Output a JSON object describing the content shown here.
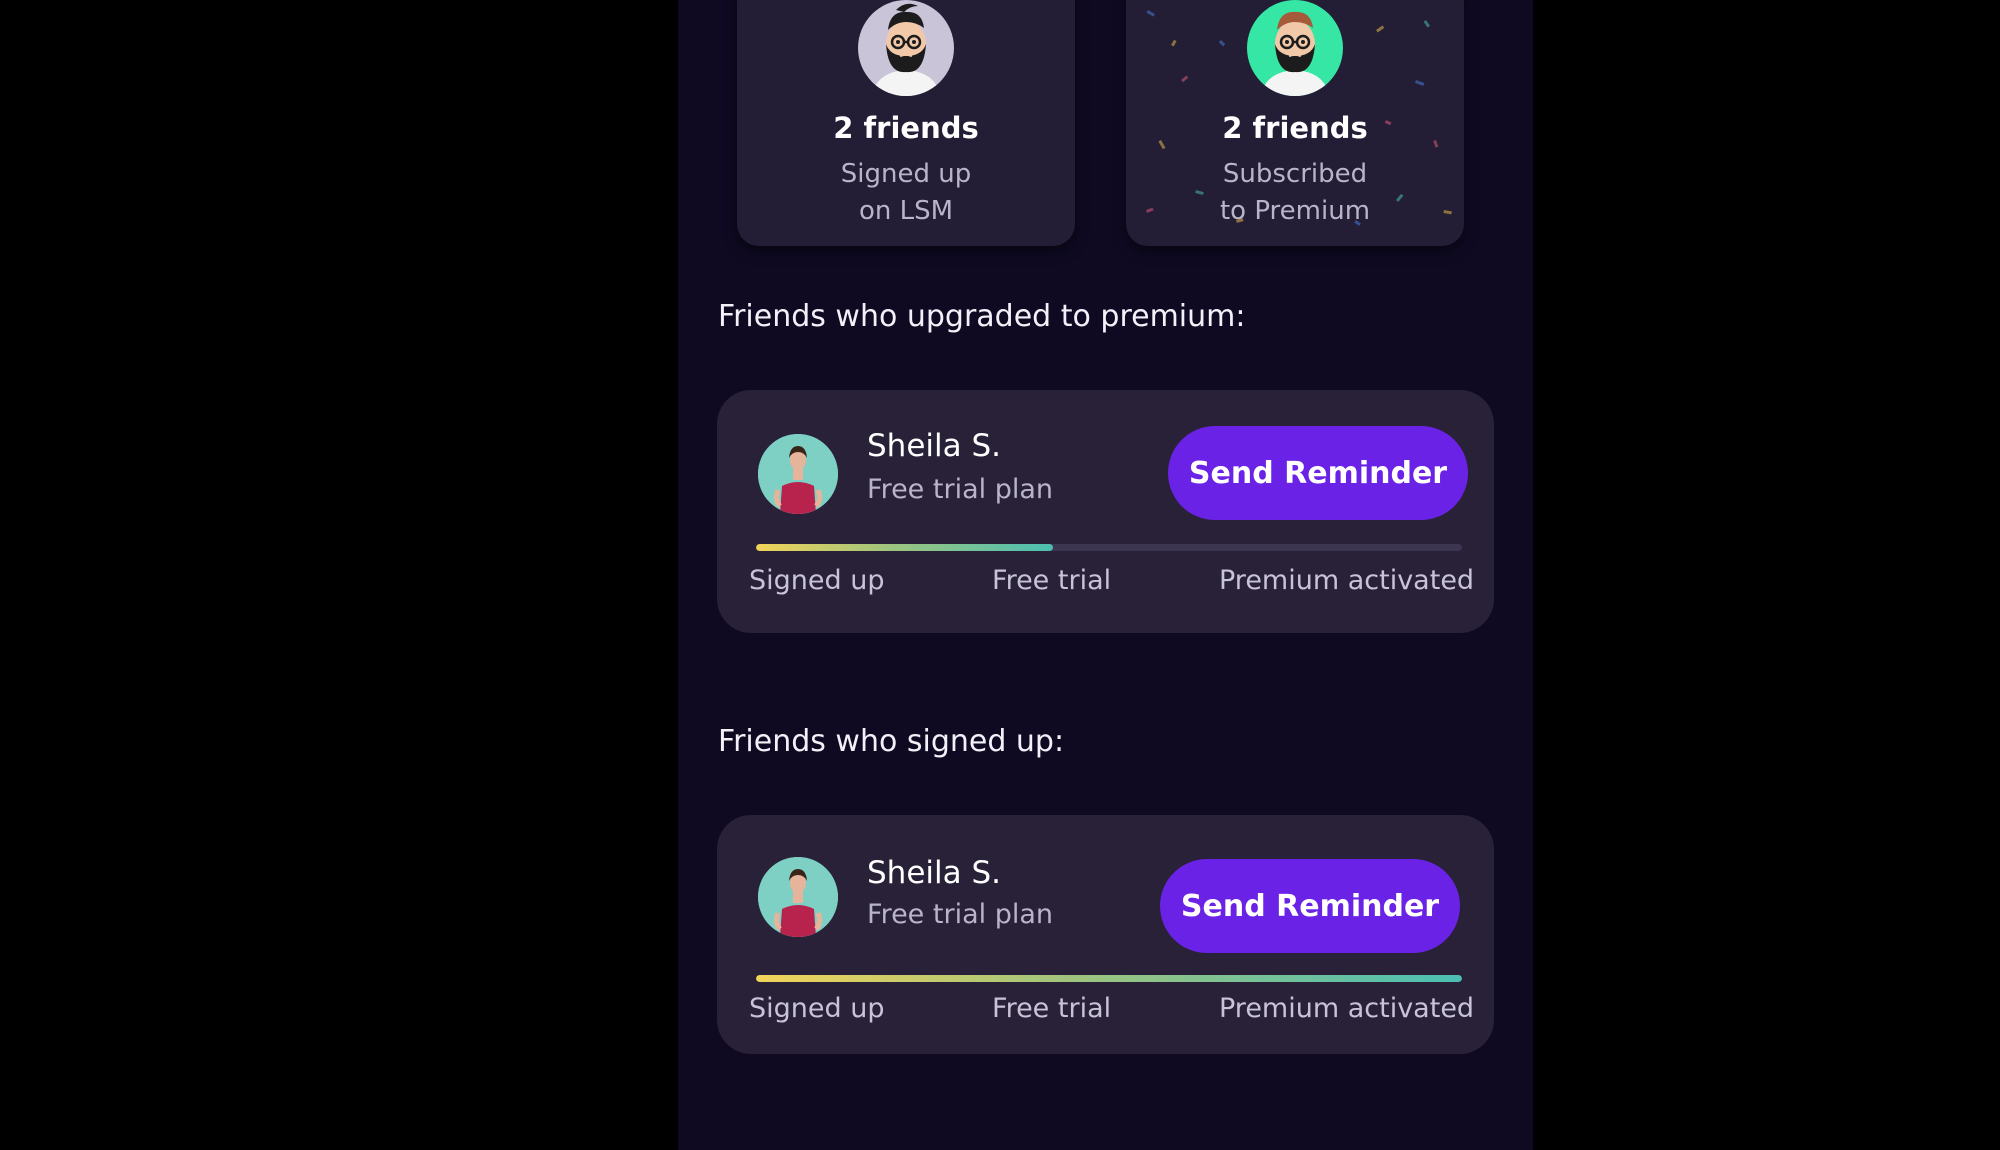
{
  "stats": [
    {
      "count": "2 friends",
      "line1": "Signed up",
      "line2": "on LSM",
      "avatar_icon": "bearded-man-avatar-icon",
      "avatar_bg": "#c9c4d8"
    },
    {
      "count": "2 friends",
      "line1": "Subscribed",
      "line2": "to Premium",
      "avatar_icon": "bearded-man-avatar-icon",
      "avatar_bg": "#36e6a4"
    }
  ],
  "sections": {
    "premium_title": "Friends who upgraded to premium:",
    "signed_title": "Friends who signed up:"
  },
  "friends": [
    {
      "name": "Sheila S.",
      "plan": "Free trial plan",
      "button": "Send Reminder",
      "progress": 0.42,
      "stages": [
        "Signed up",
        "Free trial",
        "Premium activated"
      ]
    },
    {
      "name": "Sheila S.",
      "plan": "Free trial plan",
      "button": "Send Reminder",
      "progress": 1.0,
      "stages": [
        "Signed up",
        "Free trial",
        "Premium activated"
      ]
    }
  ],
  "colors": {
    "background": "#0f0a22",
    "card": "#282138",
    "button": "#6a23e6",
    "progress_start": "#f2d35a",
    "progress_end": "#4bbfb3"
  }
}
